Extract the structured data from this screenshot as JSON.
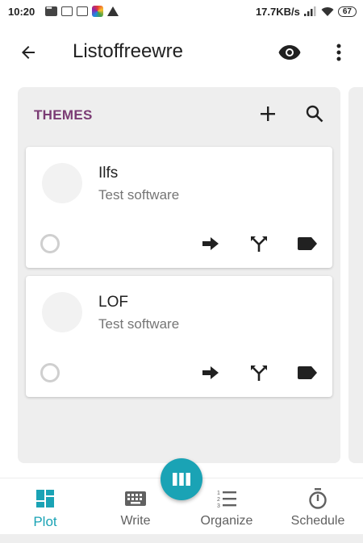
{
  "status_bar": {
    "time": "10:20",
    "net_speed": "17.7KB/s",
    "battery": "67"
  },
  "app_bar": {
    "title": "Listoffreewre",
    "icons": [
      "back-arrow-icon",
      "eye-icon",
      "more-vert-icon"
    ]
  },
  "panel": {
    "title": "THEMES",
    "icons": [
      "plus-icon",
      "search-icon"
    ],
    "cards": [
      {
        "name": "Ilfs",
        "description": "Test software",
        "actions": [
          "arrow-right-icon",
          "fork-icon",
          "label-icon"
        ]
      },
      {
        "name": "LOF",
        "description": "Test software",
        "actions": [
          "arrow-right-icon",
          "fork-icon",
          "label-icon"
        ]
      }
    ]
  },
  "bottom_nav": {
    "tabs": [
      {
        "label": "Plot",
        "icon": "dashboard-icon",
        "active": true
      },
      {
        "label": "Write",
        "icon": "keyboard-icon",
        "active": false
      },
      {
        "label": "Organize",
        "icon": "numbered-list-icon",
        "active": false
      },
      {
        "label": "Schedule",
        "icon": "timer-icon",
        "active": false
      }
    ],
    "fab_icon": "columns-icon"
  },
  "colors": {
    "accent": "#1aa3b5",
    "panel_title": "#7b3b74",
    "panel_bg": "#eeeeee"
  }
}
